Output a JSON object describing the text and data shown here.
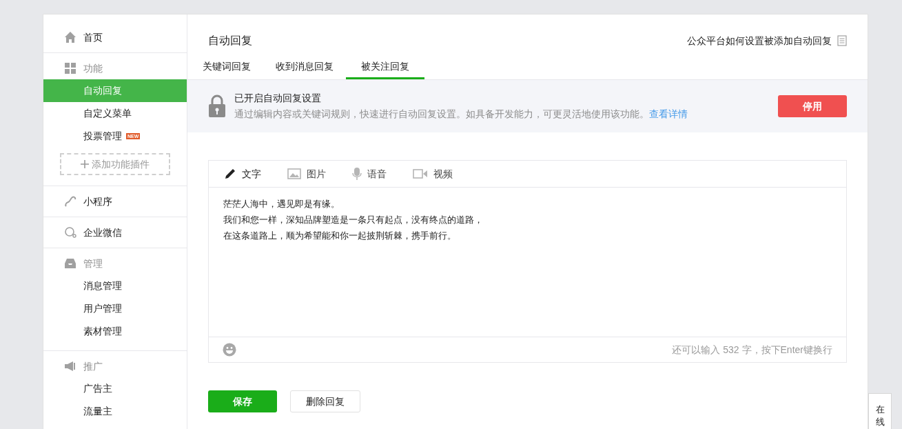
{
  "sidebar": {
    "sections": [
      {
        "label": "首页"
      },
      {
        "label": "功能",
        "items": [
          {
            "label": "自动回复",
            "selected": true
          },
          {
            "label": "自定义菜单",
            "selected": false
          },
          {
            "label": "投票管理",
            "selected": false,
            "badge": "NEW"
          }
        ],
        "add_button": "添加功能插件"
      },
      {
        "label": "小程序"
      },
      {
        "label": "企业微信"
      },
      {
        "label": "管理",
        "items": [
          {
            "label": "消息管理",
            "selected": false
          },
          {
            "label": "用户管理",
            "selected": false
          },
          {
            "label": "素材管理",
            "selected": false
          }
        ]
      },
      {
        "label": "推广",
        "items": [
          {
            "label": "广告主",
            "selected": false
          },
          {
            "label": "流量主",
            "selected": false
          }
        ]
      }
    ]
  },
  "header": {
    "title": "自动回复",
    "help_link": "公众平台如何设置被添加自动回复"
  },
  "tabs": [
    {
      "label": "关键词回复",
      "selected": false
    },
    {
      "label": "收到消息回复",
      "selected": false
    },
    {
      "label": "被关注回复",
      "selected": true
    }
  ],
  "notice": {
    "title": "已开启自动回复设置",
    "description": "通过编辑内容或关键词规则，快速进行自动回复设置。如具备开发能力，可更灵活地使用该功能。",
    "link": "查看详情",
    "button": "停用"
  },
  "editor": {
    "tools": [
      {
        "label": "文字",
        "selected": true
      },
      {
        "label": "图片",
        "selected": false
      },
      {
        "label": "语音",
        "selected": false
      },
      {
        "label": "视频",
        "selected": false
      }
    ],
    "lines": [
      "茫茫人海中，遇见即是有缘。",
      "我们和您一样，深知品牌塑造是一条只有起点，没有终点的道路，",
      "在这条道路上，顺为希望能和你一起披荆斩棘，携手前行。"
    ],
    "counter": "还可以输入 532 字，按下Enter键换行"
  },
  "actions": {
    "save": "保存",
    "delete": "删除回复"
  },
  "float_tab": "在线"
}
